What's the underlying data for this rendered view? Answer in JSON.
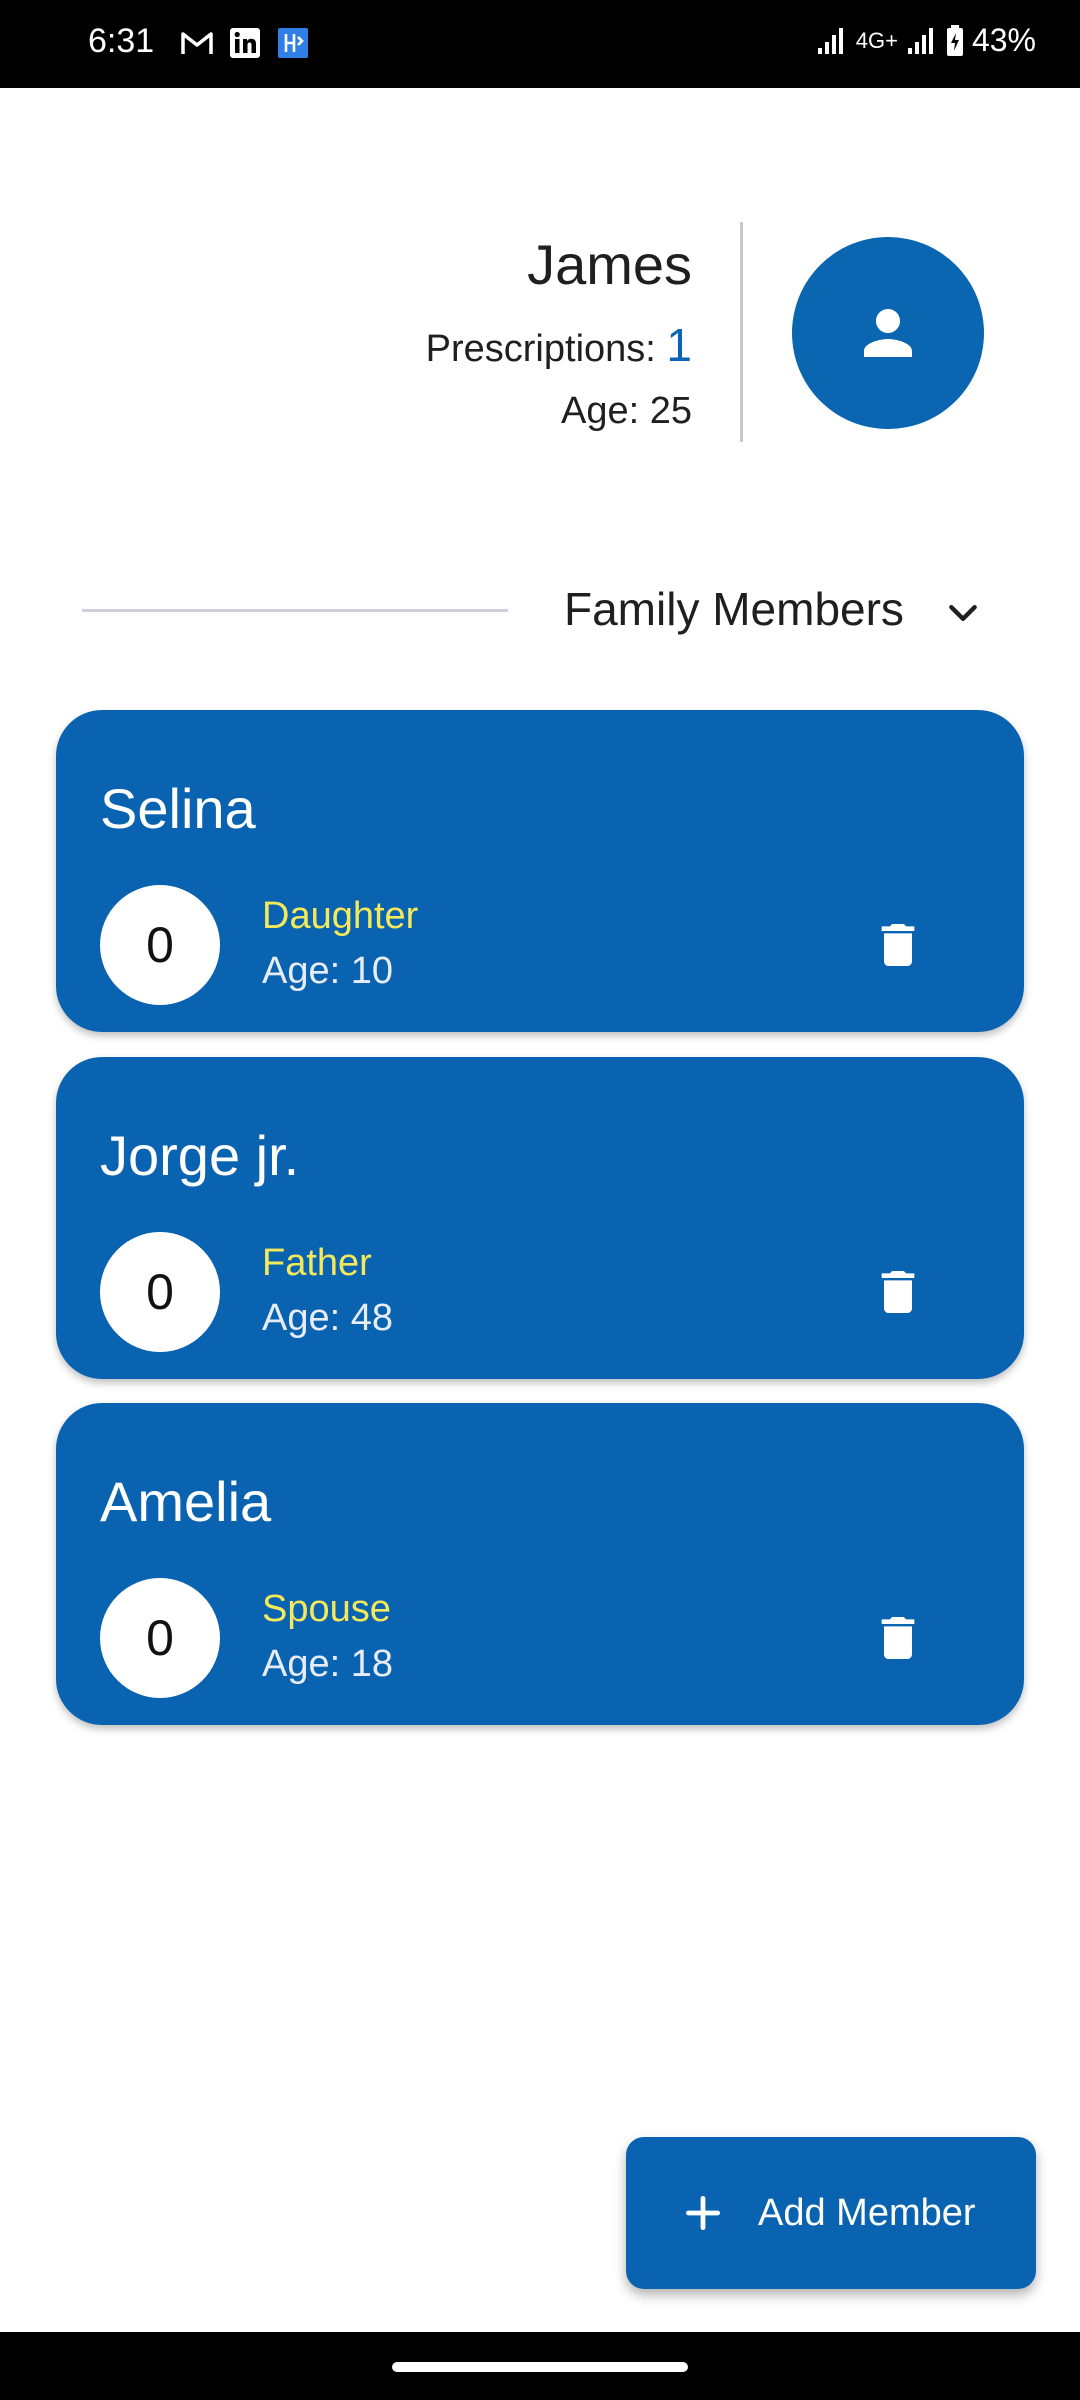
{
  "status_bar": {
    "time": "6:31",
    "notifications": [
      "gmail-icon",
      "linkedin-icon",
      "app-icon"
    ],
    "network": "4G+",
    "battery": "43%"
  },
  "profile": {
    "name": "James",
    "prescriptions_label": "Prescriptions:",
    "prescriptions_count": "1",
    "age": "Age: 25"
  },
  "family_section": {
    "title": "Family Members"
  },
  "members": [
    {
      "name": "Selina",
      "count": "0",
      "relation": "Daughter",
      "age": "Age: 10"
    },
    {
      "name": "Jorge jr.",
      "count": "0",
      "relation": "Father",
      "age": "Age: 48"
    },
    {
      "name": "Amelia",
      "count": "0",
      "relation": "Spouse",
      "age": "Age: 18"
    }
  ],
  "fab": {
    "label": "Add Member"
  },
  "colors": {
    "primary": "#0a63b0",
    "relation_text": "#f4e95a",
    "prescription_count": "#0a63b4"
  }
}
